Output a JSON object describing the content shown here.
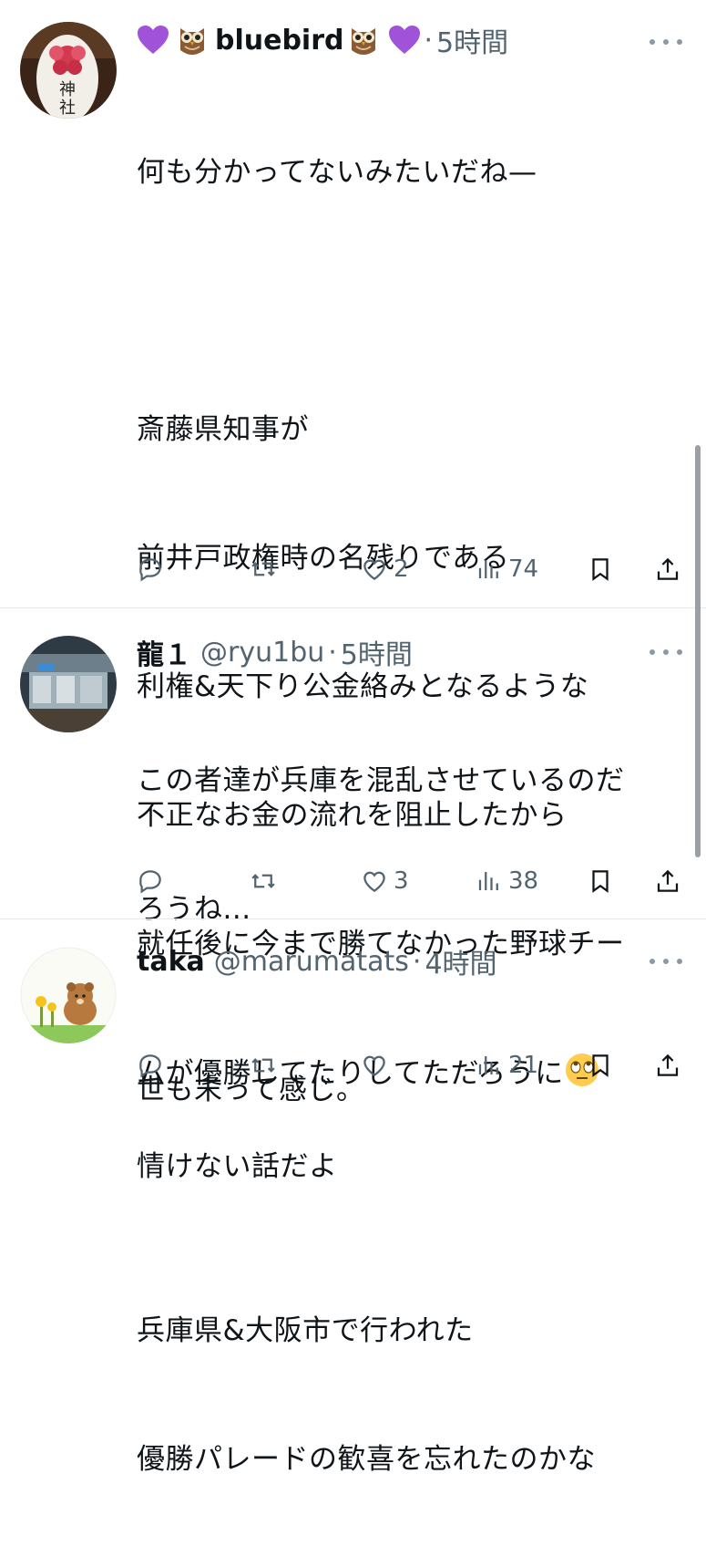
{
  "tweets": [
    {
      "name": "bluebird",
      "name_emoji_left": "💜🦉",
      "name_emoji_right": "🦉💜",
      "handle": "",
      "time": "5時間",
      "body_lines": [
        "何も分かってないみたいだね—",
        "",
        "斎藤県知事が",
        "前井戸政権時の名残りである",
        "利権&天下り公金絡みとなるような",
        "不正なお金の流れを阻止したから",
        "就任後に今まで勝てなかった野球チー",
        "ムが優勝してたりしてただろうに",
        "",
        "兵庫県&大阪市で行われた",
        "優勝パレードの歓喜を忘れたのかな"
      ],
      "rolling_eyes_emoji": "🙄",
      "replies": "",
      "retweets": "",
      "likes": "2",
      "views": "74"
    },
    {
      "name": "龍１",
      "handle": "@ryu1bu",
      "time": "5時間",
      "body_lines": [
        "この者達が兵庫を混乱させているのだ",
        "ろうね...",
        "",
        "情けない話だよ"
      ],
      "replies": "",
      "retweets": "",
      "likes": "3",
      "views": "38"
    },
    {
      "name": "taka",
      "handle": "@marumatats",
      "time": "4時間",
      "body_lines": [
        "世も末って感じ。"
      ],
      "replies": "",
      "retweets": "",
      "likes": "",
      "views": "21"
    }
  ],
  "separator_dot": "·",
  "icons": [
    "reply-icon",
    "retweet-icon",
    "like-icon",
    "views-icon",
    "bookmark-icon",
    "share-icon",
    "more-icon"
  ],
  "colors": {
    "text": "#0f1419",
    "secondary": "#536471",
    "divider": "#e6e9ec",
    "accent_purple": "#9b59d0"
  }
}
